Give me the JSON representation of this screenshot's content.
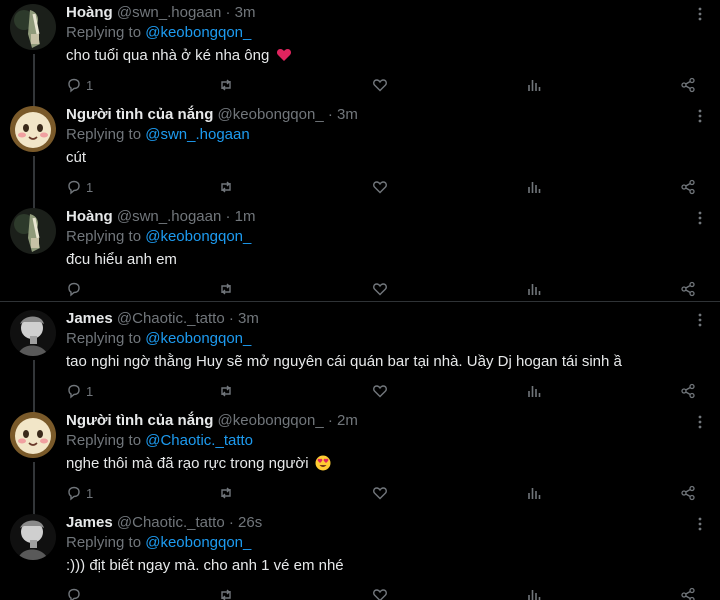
{
  "tweets": [
    {
      "name": "Hoàng",
      "handle": "@swn_.hogaan",
      "sep": "·",
      "time": "3m",
      "reply_prefix": "Replying to",
      "reply_to": "@keobongqon_",
      "text": "cho tuổi qua nhà ở ké nha ông",
      "emoji": "red-heart",
      "reply_count": "1",
      "avatar": "hoang-avatar"
    },
    {
      "name": "Người tình của nắng",
      "handle": "@keobongqon_",
      "sep": "·",
      "time": "3m",
      "reply_prefix": "Replying to",
      "reply_to": "@swn_.hogaan",
      "text": "cút",
      "emoji": "",
      "reply_count": "1",
      "avatar": "face-avatar"
    },
    {
      "name": "Hoàng",
      "handle": "@swn_.hogaan",
      "sep": "·",
      "time": "1m",
      "reply_prefix": "Replying to",
      "reply_to": "@keobongqon_",
      "text": "đcu hiểu anh em",
      "emoji": "",
      "reply_count": "",
      "avatar": "hoang-avatar"
    },
    {
      "name": "James",
      "handle": "@Chaotic._tatto",
      "sep": "·",
      "time": "3m",
      "reply_prefix": "Replying to",
      "reply_to": "@keobongqon_",
      "text": "tao nghi ngờ thằng Huy sẽ mở nguyên cái quán bar tại nhà. Uầy Dj hogan tái sinh ầ",
      "emoji": "",
      "reply_count": "1",
      "avatar": "james-avatar"
    },
    {
      "name": "Người tình của nắng",
      "handle": "@keobongqon_",
      "sep": "·",
      "time": "2m",
      "reply_prefix": "Replying to",
      "reply_to": "@Chaotic._tatto",
      "text": "nghe thôi mà đã rạo rực trong người",
      "emoji": "heart-eyes",
      "reply_count": "1",
      "avatar": "face-avatar"
    },
    {
      "name": "James",
      "handle": "@Chaotic._tatto",
      "sep": "·",
      "time": "26s",
      "reply_prefix": "Replying to",
      "reply_to": "@keobongqon_",
      "text": ":))) địt biết ngay mà. cho anh 1 vé em nhé",
      "emoji": "",
      "reply_count": "",
      "avatar": "james-avatar"
    }
  ],
  "colors": {
    "background": "#000000",
    "text": "#e7e9ea",
    "muted": "#71767b",
    "link": "#1d9bf0",
    "divider": "#2f3336"
  },
  "icons": {
    "reply": "reply-icon",
    "retweet": "retweet-icon",
    "like": "heart-icon",
    "views": "views-icon",
    "share": "share-icon",
    "more": "more-vertical-icon"
  }
}
